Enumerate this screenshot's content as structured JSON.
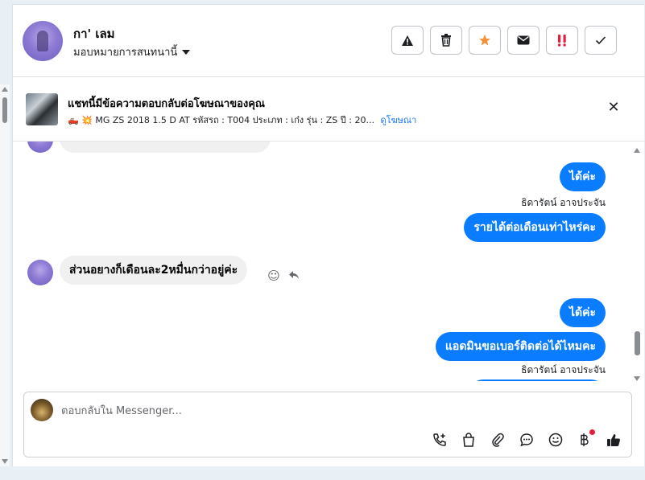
{
  "header": {
    "contact_name": "กา' เลม",
    "assign_label": "มอบหมายการสนทนานี้",
    "actions": [
      {
        "name": "report-icon",
        "glyph": "▲"
      },
      {
        "name": "trash-icon",
        "glyph": "🗑"
      },
      {
        "name": "star-icon",
        "glyph": "★"
      },
      {
        "name": "envelope-icon",
        "glyph": "✉"
      },
      {
        "name": "spam-icon",
        "glyph": "!!"
      },
      {
        "name": "check-icon",
        "glyph": "✓"
      }
    ]
  },
  "ad": {
    "title": "แชทนี้มีข้อความตอบกลับต่อโฆษณาของคุณ",
    "detail": "🛻 💥 MG ZS 2018 1.5 D AT รหัสรถ : T004 ประเภท : เก๋ง รุ่น : ZS ปี : 20...",
    "link": "ดูโฆษณา"
  },
  "messages": {
    "m1_out": "ได้ค่ะ",
    "sender1": "ธิดารัตน์ อาจประจัน",
    "m2_out": "รายได้ต่อเดือนเท่าไหร่คะ",
    "m3_in": "ส่วนอยางก็เดือนละ2หมื่นกว่าอยู่ค่ะ",
    "m4_out": "ได้ค่ะ",
    "m5_out": "แอดมินขอเบอร์ติดต่อได้ไหมคะ",
    "sender2": "ธิดารัตน์ อาจประจัน"
  },
  "composer": {
    "placeholder": "ตอบกลับใน Messenger..."
  },
  "colors": {
    "outgoing": "#0a7cff",
    "incoming": "#f0f0f0",
    "link": "#1877f2",
    "star": "#f7923a",
    "spam": "#e41e3f"
  }
}
